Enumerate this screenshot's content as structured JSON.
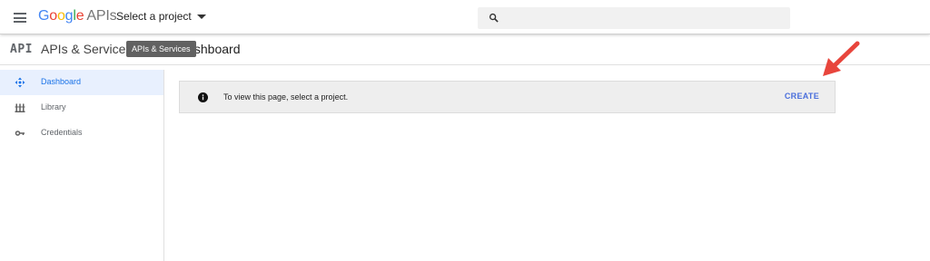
{
  "header": {
    "logo": {
      "letters": [
        "G",
        "o",
        "o",
        "g",
        "l",
        "e"
      ],
      "colors": [
        "#4285f4",
        "#ea4335",
        "#fbbc05",
        "#4285f4",
        "#34a853",
        "#ea4335"
      ]
    },
    "product": "APIs",
    "project_select": "Select a project",
    "search_placeholder": ""
  },
  "subheader": {
    "badge": "API",
    "section": "APIs & Services",
    "page_title": "Dashboard",
    "tooltip": "APIs & Services"
  },
  "sidebar": {
    "items": [
      {
        "label": "Dashboard",
        "icon": "dashboard-icon",
        "active": true
      },
      {
        "label": "Library",
        "icon": "library-icon",
        "active": false
      },
      {
        "label": "Credentials",
        "icon": "key-icon",
        "active": false
      }
    ]
  },
  "notice": {
    "message": "To view this page, select a project.",
    "action": "CREATE"
  },
  "colors": {
    "accent": "#1a73e8",
    "create": "#4a6fdc",
    "annotation_arrow": "#e8453c"
  }
}
